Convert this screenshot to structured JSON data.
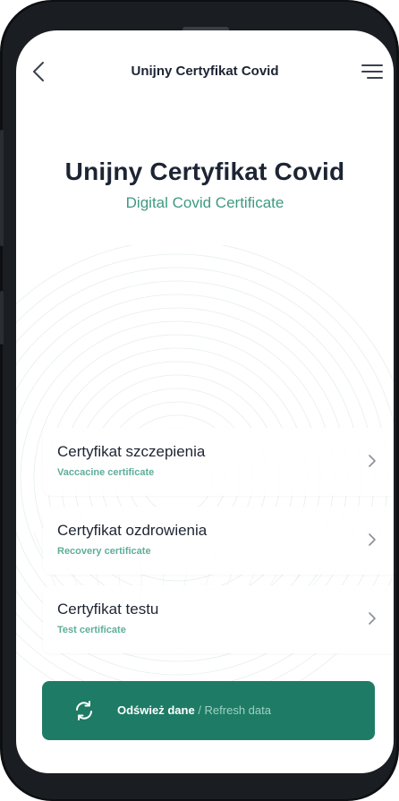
{
  "topbar": {
    "title": "Unijny Certyfikat Covid"
  },
  "hero": {
    "title": "Unijny Certyfikat Covid",
    "subtitle": "Digital Covid Certificate"
  },
  "certificates": [
    {
      "title": "Certyfikat szczepienia",
      "subtitle": "Vaccacine certificate"
    },
    {
      "title": "Certyfikat ozdrowienia",
      "subtitle": "Recovery certificate"
    },
    {
      "title": "Certyfikat testu",
      "subtitle": "Test certificate"
    }
  ],
  "refresh": {
    "label_pl": "Odśwież dane",
    "separator": " / ",
    "label_en": "Refresh data"
  },
  "colors": {
    "accent": "#1e7b66",
    "accent_text": "#3d9a82",
    "title": "#1d2433"
  },
  "icons": {
    "back": "chevron-left-icon",
    "menu": "hamburger-menu-icon",
    "chevron": "chevron-right-icon",
    "refresh": "refresh-icon"
  }
}
